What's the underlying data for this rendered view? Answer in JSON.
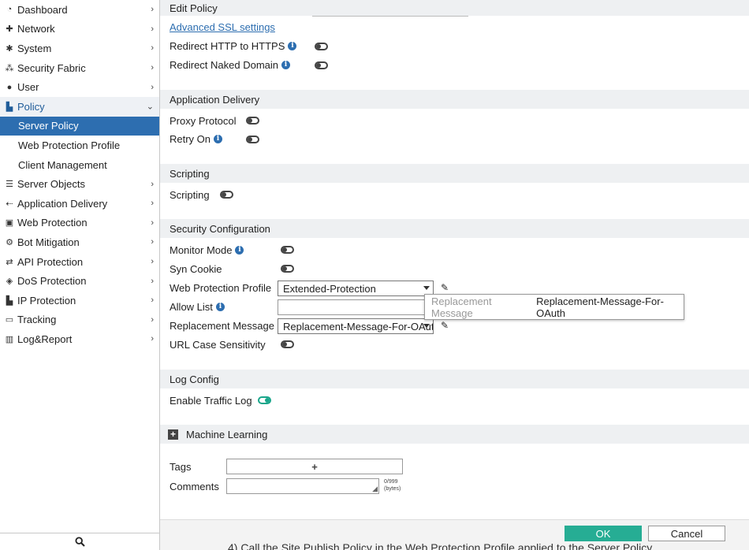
{
  "sidebar": {
    "items": [
      {
        "label": "Dashboard",
        "icon": "dashboard-icon"
      },
      {
        "label": "Network",
        "icon": "network-icon"
      },
      {
        "label": "System",
        "icon": "gear-icon"
      },
      {
        "label": "Security Fabric",
        "icon": "fabric-icon"
      },
      {
        "label": "User",
        "icon": "user-icon"
      },
      {
        "label": "Policy",
        "icon": "policy-icon",
        "open": true,
        "children": [
          "Server Policy",
          "Web Protection Profile",
          "Client Management"
        ]
      },
      {
        "label": "Server Objects",
        "icon": "server-icon"
      },
      {
        "label": "Application Delivery",
        "icon": "delivery-icon"
      },
      {
        "label": "Web Protection",
        "icon": "lock-icon"
      },
      {
        "label": "Bot Mitigation",
        "icon": "gears-icon"
      },
      {
        "label": "API Protection",
        "icon": "api-icon"
      },
      {
        "label": "DoS Protection",
        "icon": "shield-icon"
      },
      {
        "label": "IP Protection",
        "icon": "ip-icon"
      },
      {
        "label": "Tracking",
        "icon": "laptop-icon"
      },
      {
        "label": "Log&Report",
        "icon": "chart-icon"
      }
    ],
    "active_sub": "Server Policy"
  },
  "main": {
    "header": "Edit Policy",
    "advanced_ssl": "Advanced SSL settings",
    "redirect_http": "Redirect HTTP to HTTPS",
    "redirect_naked": "Redirect Naked Domain",
    "app_delivery": {
      "title": "Application Delivery",
      "proxy_protocol": "Proxy Protocol",
      "retry_on": "Retry On"
    },
    "scripting": {
      "title": "Scripting",
      "label": "Scripting"
    },
    "security": {
      "title": "Security Configuration",
      "monitor_mode": "Monitor Mode",
      "syn_cookie": "Syn Cookie",
      "wpp_label": "Web Protection Profile",
      "wpp_value": "Extended-Protection",
      "allow_list": "Allow List",
      "replacement_label": "Replacement Message",
      "replacement_value": "Replacement-Message-For-OAuth",
      "url_case": "URL Case Sensitivity"
    },
    "tooltip": {
      "key": "Replacement Message",
      "value": "Replacement-Message-For-OAuth"
    },
    "log_config": {
      "title": "Log Config",
      "enable_traffic_log": "Enable Traffic Log"
    },
    "machine_learning": "Machine Learning",
    "tags": "Tags",
    "tags_add": "+",
    "comments": "Comments",
    "comments_count": "0/999",
    "comments_unit": "(bytes)"
  },
  "buttons": {
    "ok": "OK",
    "cancel": "Cancel"
  },
  "background_text": "4) Call the Site Publish Policy in the Web Protection Profile applied to the Server Policy",
  "colors": {
    "accent": "#2d6eb0",
    "ok_button": "#26ad94",
    "toggle_on": "#1aa68b",
    "section_bg": "#eef0f2"
  }
}
